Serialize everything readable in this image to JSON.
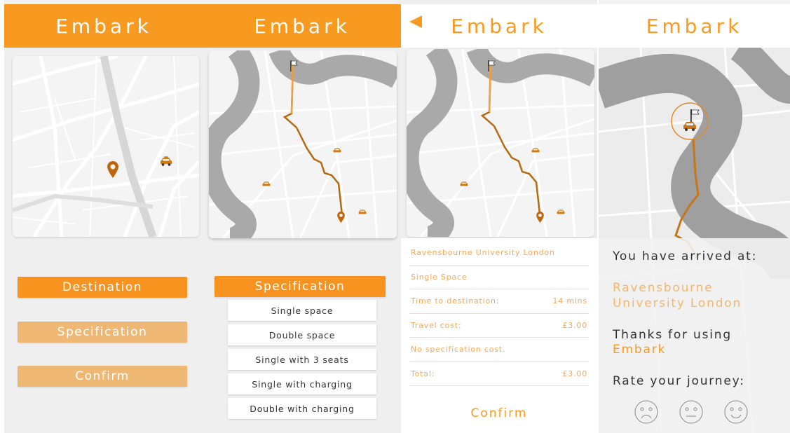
{
  "app": {
    "title": "Embark",
    "accent": "#f89a20"
  },
  "screen1": {
    "buttons": {
      "destination": "Destination",
      "specification": "Specification",
      "confirm": "Confirm"
    }
  },
  "screen2": {
    "heading_button": "Specification",
    "options": [
      "Single space",
      "Double space",
      "Single with 3 seats",
      "Single with charging",
      "Double with charging"
    ]
  },
  "screen3": {
    "rows": [
      {
        "label": "Ravensbourne University London",
        "value": ""
      },
      {
        "label": "Single Space",
        "value": ""
      },
      {
        "label": "Time to destination:",
        "value": "14 mins"
      },
      {
        "label": "Travel cost:",
        "value": "£3.00"
      },
      {
        "label": "No specification cost.",
        "value": ""
      },
      {
        "label": "Total:",
        "value": "£3.00"
      }
    ],
    "confirm": "Confirm"
  },
  "screen4": {
    "arrived": "You have arrived at:",
    "place_line1": "Ravensbourne",
    "place_line2": "University London",
    "thanks": "Thanks for using",
    "brand": "Embark",
    "rate": "Rate your journey:",
    "faces": [
      "sad-face-icon",
      "neutral-face-icon",
      "happy-face-icon"
    ]
  }
}
